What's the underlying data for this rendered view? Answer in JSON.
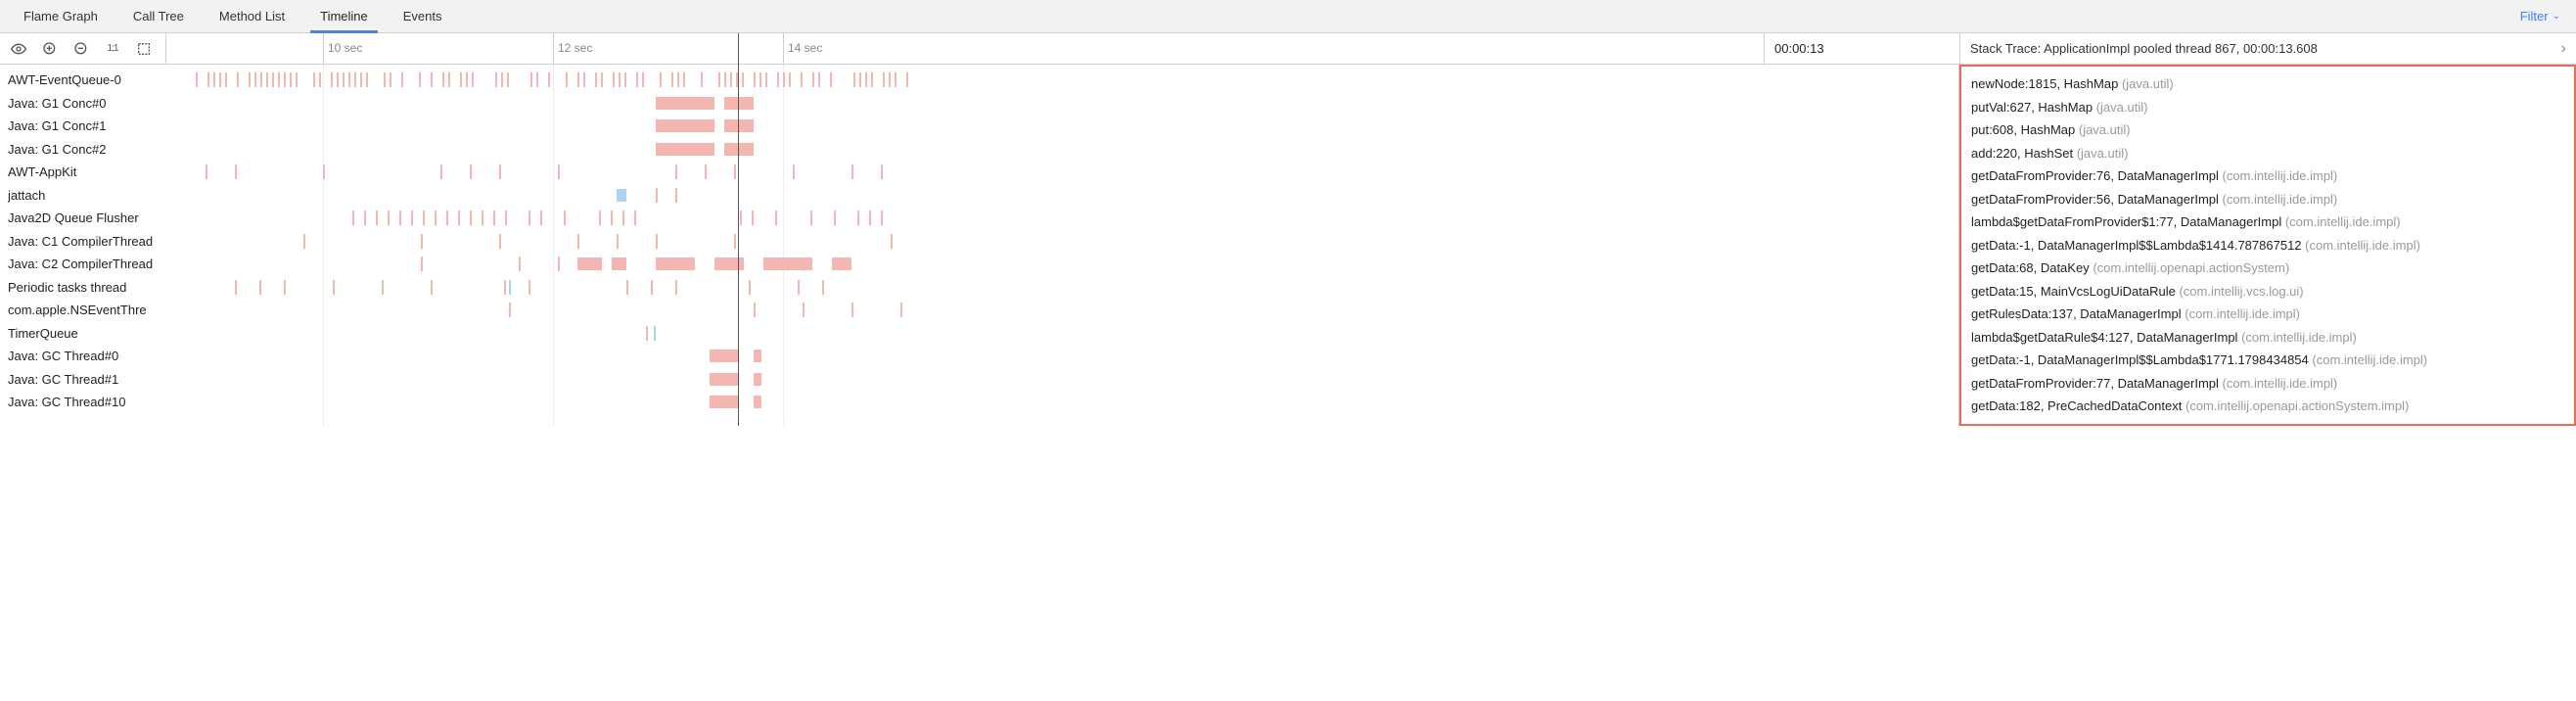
{
  "tabs": {
    "flame_graph": "Flame Graph",
    "call_tree": "Call Tree",
    "method_list": "Method List",
    "timeline": "Timeline",
    "events": "Events",
    "filter": "Filter"
  },
  "ruler": {
    "tick1": "10 sec",
    "tick2": "12 sec",
    "tick3": "14 sec"
  },
  "time_indicator": "00:00:13",
  "stack_header": "Stack Trace: ApplicationImpl pooled thread 867, 00:00:13.608",
  "threads": [
    "AWT-EventQueue-0",
    "Java: G1 Conc#0",
    "Java: G1 Conc#1",
    "Java: G1 Conc#2",
    "AWT-AppKit",
    "jattach",
    "Java2D Queue Flusher",
    "Java: C1 CompilerThread",
    "Java: C2 CompilerThread",
    "Periodic tasks thread",
    "com.apple.NSEventThre",
    "TimerQueue",
    "Java: GC Thread#0",
    "Java: GC Thread#1",
    "Java: GC Thread#10"
  ],
  "stack": [
    {
      "m": "newNode:1815, HashMap",
      "p": "(java.util)"
    },
    {
      "m": "putVal:627, HashMap",
      "p": "(java.util)"
    },
    {
      "m": "put:608, HashMap",
      "p": "(java.util)"
    },
    {
      "m": "add:220, HashSet",
      "p": "(java.util)"
    },
    {
      "m": "getDataFromProvider:76, DataManagerImpl",
      "p": "(com.intellij.ide.impl)"
    },
    {
      "m": "getDataFromProvider:56, DataManagerImpl",
      "p": "(com.intellij.ide.impl)"
    },
    {
      "m": "lambda$getDataFromProvider$1:77, DataManagerImpl",
      "p": "(com.intellij.ide.impl)"
    },
    {
      "m": "getData:-1, DataManagerImpl$$Lambda$1414.787867512",
      "p": "(com.intellij.ide.impl)"
    },
    {
      "m": "getData:68, DataKey",
      "p": "(com.intellij.openapi.actionSystem)"
    },
    {
      "m": "getData:15, MainVcsLogUiDataRule",
      "p": "(com.intellij.vcs.log.ui)"
    },
    {
      "m": "getRulesData:137, DataManagerImpl",
      "p": "(com.intellij.ide.impl)"
    },
    {
      "m": "lambda$getDataRule$4:127, DataManagerImpl",
      "p": "(com.intellij.ide.impl)"
    },
    {
      "m": "getData:-1, DataManagerImpl$$Lambda$1771.1798434854",
      "p": "(com.intellij.ide.impl)"
    },
    {
      "m": "getDataFromProvider:77, DataManagerImpl",
      "p": "(com.intellij.ide.impl)"
    },
    {
      "m": "getData:182, PreCachedDataContext",
      "p": "(com.intellij.openapi.actionSystem.impl)"
    }
  ],
  "colors": {
    "accent": "#e86b5c",
    "bar": "#f4b6b0",
    "blue": "#aed3f0",
    "link": "#3b82f6"
  }
}
